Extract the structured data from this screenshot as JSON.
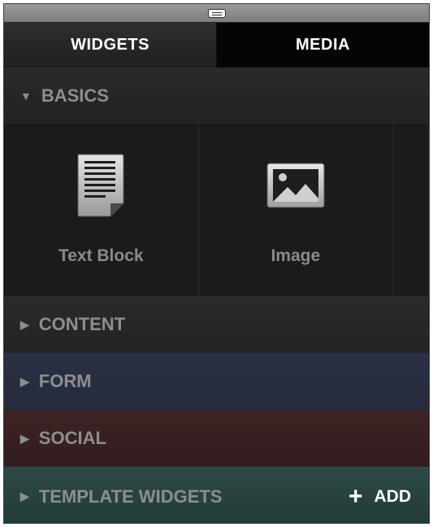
{
  "tabs": [
    {
      "label": "WIDGETS",
      "selected": true
    },
    {
      "label": "MEDIA",
      "selected": false
    }
  ],
  "sections": {
    "basics": {
      "label": "BASICS",
      "expanded": true,
      "items": [
        {
          "label": "Text Block",
          "icon": "document-icon"
        },
        {
          "label": "Image",
          "icon": "image-icon"
        }
      ]
    },
    "content": {
      "label": "CONTENT",
      "expanded": false,
      "color": "#262626"
    },
    "form": {
      "label": "FORM",
      "expanded": false,
      "color": "#282e41"
    },
    "social": {
      "label": "SOCIAL",
      "expanded": false,
      "color": "#381f20"
    },
    "template": {
      "label": "TEMPLATE WIDGETS",
      "expanded": false,
      "color": "#27433f",
      "add_label": "ADD"
    }
  },
  "icons": {
    "expanded_arrow": "▼",
    "collapsed_arrow": "▶",
    "add": "+"
  }
}
